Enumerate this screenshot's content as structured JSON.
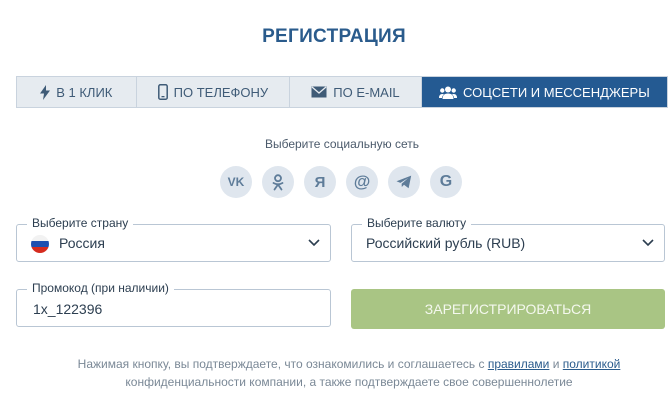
{
  "title": "РЕГИСТРАЦИЯ",
  "tabs": [
    {
      "label": "В 1 КЛИК",
      "icon": "lightning-icon"
    },
    {
      "label": "ПО ТЕЛЕФОНУ",
      "icon": "phone-icon"
    },
    {
      "label": "ПО E-MAIL",
      "icon": "envelope-icon"
    },
    {
      "label": "СОЦСЕТИ И МЕССЕНДЖЕРЫ",
      "icon": "users-icon",
      "active": true
    }
  ],
  "social": {
    "caption": "Выберите социальную сеть",
    "networks": [
      {
        "name": "vk",
        "glyph": "VK"
      },
      {
        "name": "odnoklassniki",
        "glyph": "ok"
      },
      {
        "name": "yandex",
        "glyph": "Я"
      },
      {
        "name": "mail",
        "glyph": "@"
      },
      {
        "name": "telegram",
        "glyph": ""
      },
      {
        "name": "google",
        "glyph": "G"
      }
    ]
  },
  "country": {
    "legend": "Выберите страну",
    "value": "Россия"
  },
  "currency": {
    "legend": "Выберите валюту",
    "value": "Российский рубль (RUB)"
  },
  "promo": {
    "legend": "Промокод (при наличии)",
    "value": "1x_122396"
  },
  "register_button": "ЗАРЕГИСТРИРОВАТЬСЯ",
  "consent": {
    "part1": "Нажимая кнопку, вы подтверждаете, что ознакомились и соглашаетесь с ",
    "link_rules": "правилами",
    "and": " и ",
    "link_policy": "политикой",
    "part2": "конфиденциальности компании, а также подтверждаете свое совершеннолетие"
  },
  "colors": {
    "title": "#2a5b8c",
    "tab_active": "#245a92",
    "tab_inactive": "#e6ebf0",
    "button": "#a9c584",
    "social_bg": "#dfe6ee"
  }
}
